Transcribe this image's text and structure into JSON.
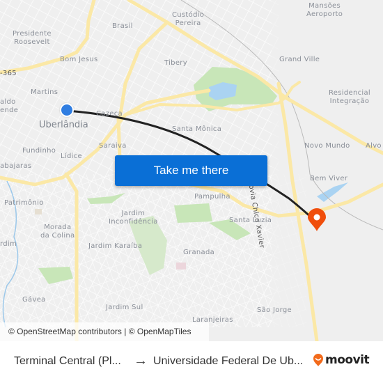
{
  "map": {
    "labels": {
      "presidente_roosevelt": "Presidente\nRoosevelt",
      "brasil": "Brasil",
      "custodio_pereira": "Custódio\nPereira",
      "mansoes_aeroporto": "Mansões\nAeroporto",
      "bom_jesus": "Bom Jesus",
      "br365": "-365",
      "tibery": "Tibery",
      "grand_ville": "Grand Ville",
      "martins": "Martins",
      "aldo_ende": "aldo\nende",
      "residencial_integracao": "Residencial\nIntegração",
      "uberlandia": "Uberlândia",
      "cazeca": "Cazeca",
      "santa_monica": "Santa Mônica",
      "fundinho": "Fundinho",
      "lidice": "Lídice",
      "saraiva": "Saraiva",
      "novo_mundo": "Novo Mundo",
      "alvo": "Alvo",
      "tabajaras": "abajaras",
      "rodovia": "Rodovia Chico Xavier",
      "bem_viver": "Bem Viver",
      "patrimonio": "Patrimônio",
      "pampulha": "Pampulha",
      "jardim_inconfidencia": "Jardim\nInconfidência",
      "santa_luzia": "Santa Luzia",
      "morada_colina": "Morada\nda Colina",
      "jardim_left": "rdim",
      "jardim_karaiba": "Jardim Karaíba",
      "granada": "Granada",
      "gavea": "Gávea",
      "jardim_sul": "Jardim Sul",
      "sao_jorge": "São Jorge",
      "laranjeiras": "Laranjeiras"
    },
    "attribution": "© OpenStreetMap contributors | © OpenMapTiles",
    "cta_button": "Take me there",
    "colors": {
      "route": "#222222",
      "origin": "#2f7de1",
      "destination": "#f04e0c",
      "button": "#0a6fd6",
      "road_major": "#fbe8a6",
      "park": "#c8e6b8",
      "water": "#aad3f2"
    }
  },
  "footer": {
    "from": "Terminal Central (Pl...",
    "arrow": "→",
    "to": "Universidade Federal De Ub...",
    "brand": "moovit"
  }
}
